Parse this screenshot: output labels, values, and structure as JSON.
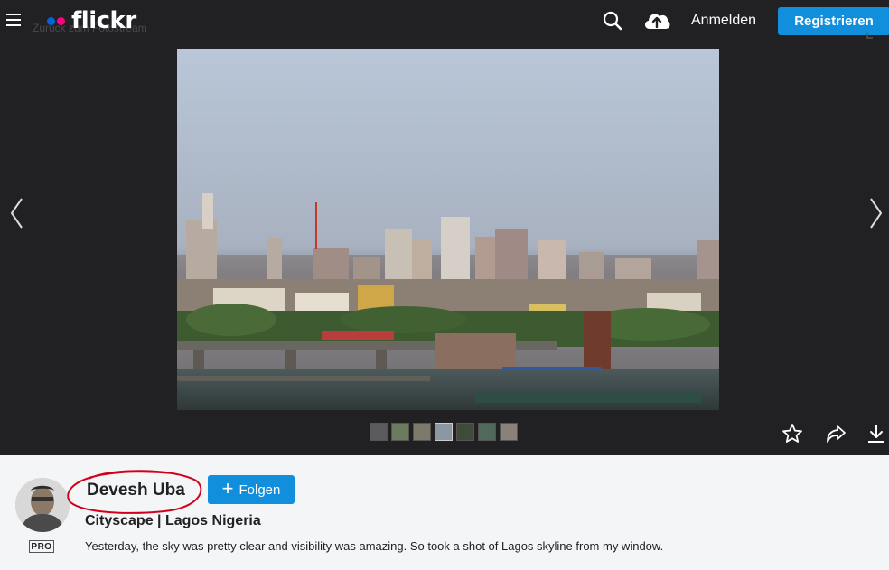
{
  "header": {
    "logo_text": "flickr",
    "ghost_text": "Zurück zum Fotostream",
    "login_label": "Anmelden",
    "register_label": "Registrieren"
  },
  "photo": {
    "thumbnail_count": 7,
    "selected_thumbnail": 4
  },
  "author": {
    "name": "Devesh Uba",
    "badge": "PRO",
    "follow_label": "Folgen",
    "follow_icon": "plus-icon"
  },
  "details": {
    "title": "Cityscape | Lagos Nigeria",
    "description": "Yesterday, the sky was pretty clear and visibility was amazing. So took a shot of Lagos skyline from my window."
  },
  "colors": {
    "topbar_bg": "#212124",
    "accent_blue": "#128fdc",
    "logo_blue": "#0063dc",
    "logo_pink": "#ff0084",
    "info_bg": "#f3f5f6",
    "annotation_red": "#d0021b"
  }
}
